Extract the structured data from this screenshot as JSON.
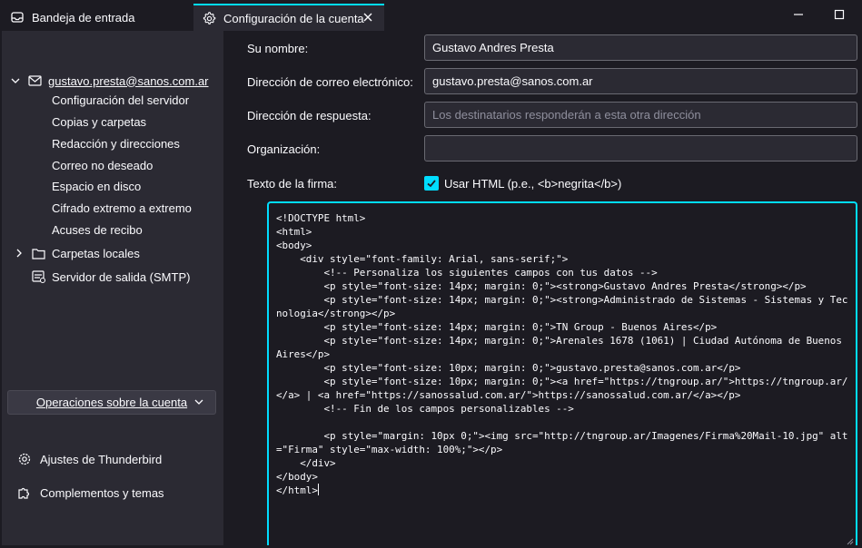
{
  "tabs": [
    {
      "label": "Bandeja de entrada",
      "icon": "inbox-icon"
    },
    {
      "label": "Configuración de la cuenta",
      "icon": "gear-icon",
      "active": true
    }
  ],
  "sidebar": {
    "account": {
      "label": "gustavo.presta@sanos.com.ar",
      "icon": "mail-account-icon",
      "expanded": true
    },
    "account_items": [
      "Configuración del servidor",
      "Copias y carpetas",
      "Redacción y direcciones",
      "Correo no deseado",
      "Espacio en disco",
      "Cifrado extremo a extremo",
      "Acuses de recibo"
    ],
    "local_folders": "Carpetas locales",
    "smtp": "Servidor de salida (SMTP)",
    "operations_button": "Operaciones sobre la cuenta",
    "footer": {
      "settings": "Ajustes de Thunderbird",
      "addons": "Complementos y temas"
    }
  },
  "form": {
    "name_label": "Su nombre:",
    "name_value": "Gustavo Andres Presta",
    "email_label": "Dirección de correo electrónico:",
    "email_value": "gustavo.presta@sanos.com.ar",
    "reply_label": "Dirección de respuesta:",
    "reply_placeholder": "Los destinatarios responderán a esta otra dirección",
    "org_label": "Organización:",
    "org_value": "",
    "signature_label": "Texto de la firma:",
    "use_html_label": "Usar HTML (p.e., <b>negrita</b>)",
    "use_html_checked": true,
    "signature_text": "<!DOCTYPE html>\n<html>\n<body>\n    <div style=\"font-family: Arial, sans-serif;\">\n        <!-- Personaliza los siguientes campos con tus datos -->\n        <p style=\"font-size: 14px; margin: 0;\"><strong>Gustavo Andres Presta</strong></p>\n        <p style=\"font-size: 14px; margin: 0;\"><strong>Administrado de Sistemas - Sistemas y Tecnologia</strong></p>\n        <p style=\"font-size: 14px; margin: 0;\">TN Group - Buenos Aires</p>\n        <p style=\"font-size: 14px; margin: 0;\">Arenales 1678 (1061) | Ciudad Autónoma de Buenos Aires</p>\n        <p style=\"font-size: 10px; margin: 0;\">gustavo.presta@sanos.com.ar</p>\n        <p style=\"font-size: 10px; margin: 0;\"><a href=\"https://tngroup.ar/\">https://tngroup.ar/</a> | <a href=\"https://sanossalud.com.ar/\">https://sanossalud.com.ar/</a></p>\n        <!-- Fin de los campos personalizables -->\n\n        <p style=\"margin: 10px 0;\"><img src=\"http://tngroup.ar/Imagenes/Firma%20Mail-10.jpg\" alt=\"Firma\" style=\"max-width: 100%;\"></p>\n    </div>\n</body>\n</html>"
  },
  "colors": {
    "accent": "#00ddff",
    "background": "#1c1b22",
    "panel": "#2b2a33"
  }
}
